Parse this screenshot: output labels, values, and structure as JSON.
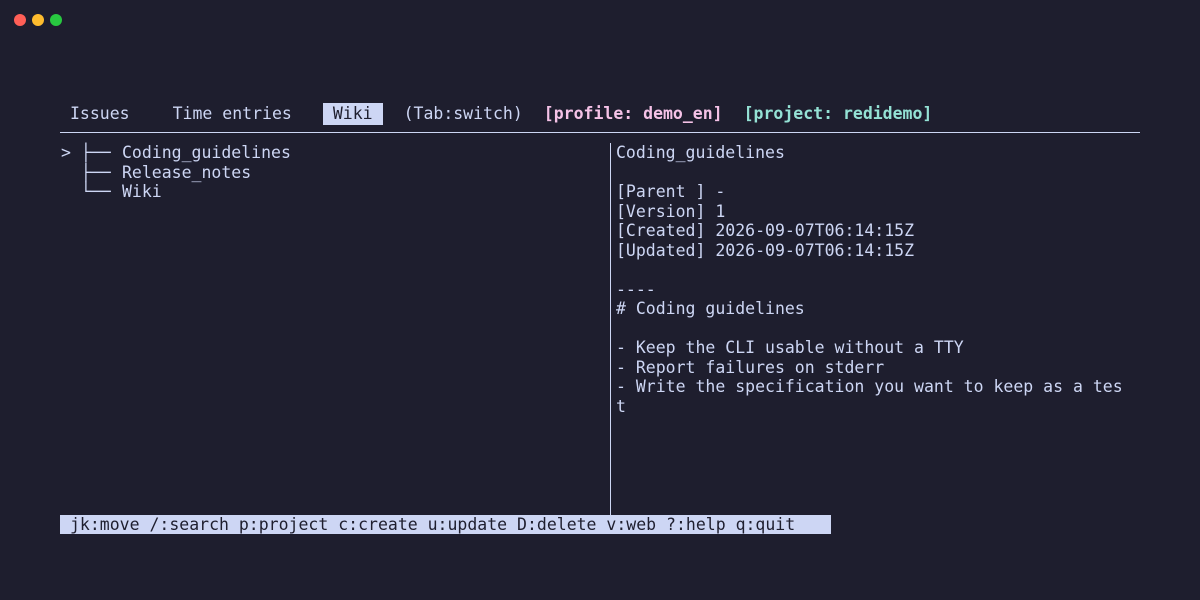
{
  "window": {
    "controls": [
      "close",
      "minimize",
      "maximize"
    ]
  },
  "tabs": {
    "items": [
      {
        "label": "Issues",
        "active": false
      },
      {
        "label": "Time entries",
        "active": false
      },
      {
        "label": "Wiki",
        "active": true
      }
    ],
    "switch_hint": "(Tab:switch)",
    "profile": "[profile: demo_en]",
    "project": "[project: redidemo]"
  },
  "tree": {
    "cursor": ">",
    "items": [
      {
        "branch": "├──",
        "label": "Coding_guidelines",
        "selected": true
      },
      {
        "branch": "├──",
        "label": "Release_notes",
        "selected": false
      },
      {
        "branch": "└──",
        "label": "Wiki",
        "selected": false
      }
    ]
  },
  "detail": {
    "lines": [
      "Coding_guidelines",
      "",
      "[Parent ] -",
      "[Version] 1",
      "[Created] 2026-09-07T06:14:15Z",
      "[Updated] 2026-09-07T06:14:15Z",
      "",
      "----",
      "# Coding guidelines",
      "",
      "- Keep the CLI usable without a TTY",
      "- Report failures on stderr",
      "- Write the specification you want to keep as a tes",
      "t"
    ]
  },
  "statusbar": {
    "text": "jk:move /:search p:project c:create u:update D:delete v:web ?:help q:quit"
  },
  "colors": {
    "background": "#1e1e2e",
    "foreground": "#cdd6f4",
    "profile": "#f5c2e7",
    "project": "#94e2d5",
    "close": "#ff5f57",
    "minimize": "#febc2e",
    "maximize": "#28c840"
  }
}
